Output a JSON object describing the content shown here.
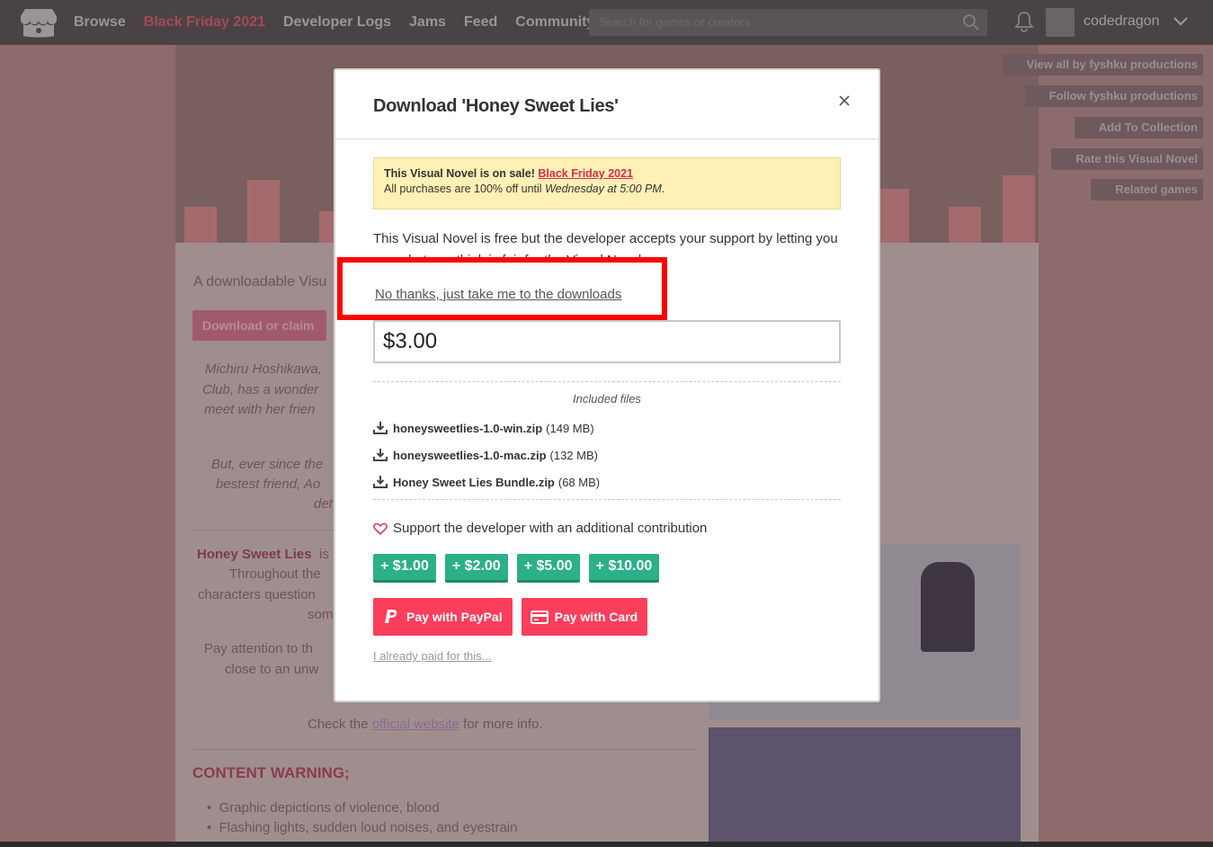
{
  "nav": {
    "links": [
      "Browse",
      "Black Friday 2021",
      "Developer Logs",
      "Jams",
      "Feed",
      "Community"
    ],
    "search_placeholder": "Search for games or creators",
    "username": "codedragon"
  },
  "side_buttons": [
    "View all by fyshku productions",
    "Follow fyshku productions",
    "Add To Collection",
    "Rate this Visual Novel",
    "Related games"
  ],
  "background": {
    "tagline": "A downloadable Visu",
    "download_button": "Download or claim",
    "para1": [
      "Michiru Hoshikawa,",
      "Club, has a wonder",
      "meet with her frien"
    ],
    "para2": [
      "But, ever since the",
      "bestest friend, Ao",
      "det"
    ],
    "para3_title": "Honey Sweet Lies",
    "para3_rest": "is",
    "para3": [
      "Throughout the",
      "characters question",
      "som"
    ],
    "para4": [
      "Pay attention to th",
      "close to an unw"
    ],
    "check_pre": "Check the",
    "check_link": "official website",
    "check_post": "for more info.",
    "warning_heading": "CONTENT WARNING;",
    "warnings": [
      "Graphic depictions of violence, blood",
      "Flashing lights, sudden loud noises, and eyestrain"
    ]
  },
  "modal": {
    "title": "Download 'Honey Sweet Lies'",
    "sale": {
      "prefix": "This Visual Novel is on sale!",
      "link": "Black Friday 2021",
      "line2_pre": "All purchases are 100% off until",
      "line2_when": "Wednesday at 5:00 PM",
      "line2_post": "."
    },
    "intro": "This Visual Novel is free but the developer accepts your support by letting you pay what you think is fair for the Visual Novel.",
    "no_thanks": "No thanks, just take me to the downloads",
    "price_value": "$3.00",
    "included_label": "Included files",
    "files": [
      {
        "name": "honeysweetlies-1.0-win.zip",
        "size": "(149 MB)"
      },
      {
        "name": "honeysweetlies-1.0-mac.zip",
        "size": "(132 MB)"
      },
      {
        "name": "Honey Sweet Lies Bundle.zip",
        "size": "(68 MB)"
      }
    ],
    "support_label": "Support the developer with an additional contribution",
    "tips": [
      "$1.00",
      "$2.00",
      "$5.00",
      "$10.00"
    ],
    "pay_paypal": "Pay with PayPal",
    "pay_card": "Pay with Card",
    "already_paid": "I already paid for this..."
  },
  "colors": {
    "highlight": "#ff0000",
    "tip_green": "#2bb087",
    "pay_red": "#fa3e5b",
    "sale_bg": "#fff1b6"
  }
}
